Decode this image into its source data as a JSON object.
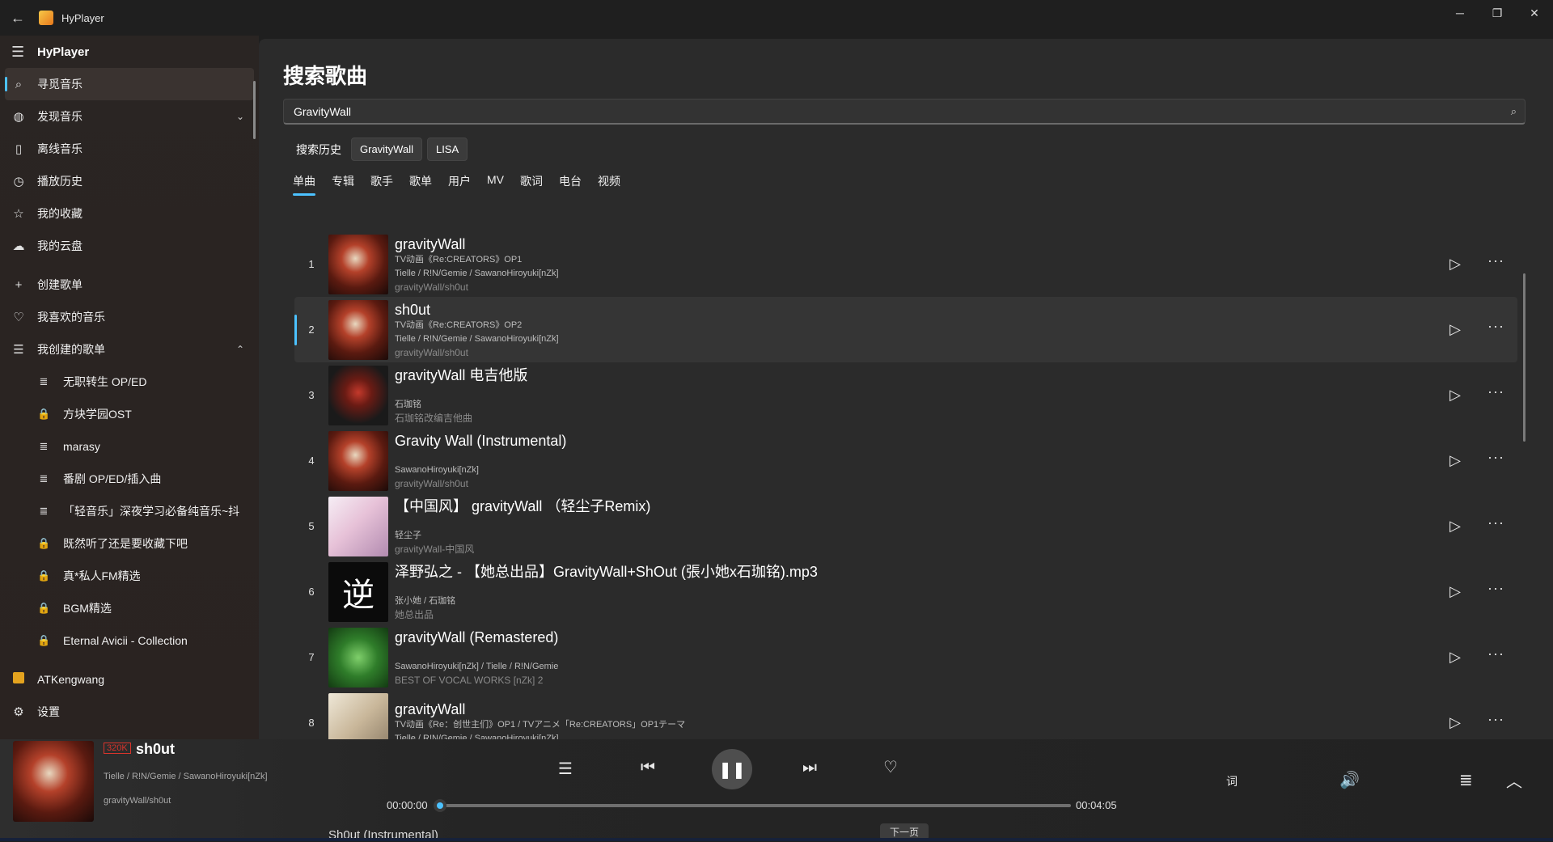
{
  "window": {
    "title": "HyPlayer",
    "controls": [
      "─",
      "❐",
      "✕"
    ]
  },
  "sidebar": {
    "header": "HyPlayer",
    "nav": [
      {
        "label": "寻觅音乐",
        "icon": "search-icon",
        "glyph": "⌕",
        "active": true
      },
      {
        "label": "发现音乐",
        "icon": "globe-icon",
        "glyph": "◍",
        "expandable": true
      },
      {
        "label": "离线音乐",
        "icon": "bookmark-icon",
        "glyph": "▯"
      },
      {
        "label": "播放历史",
        "icon": "clock-icon",
        "glyph": "◷"
      },
      {
        "label": "我的收藏",
        "icon": "star-icon",
        "glyph": "☆"
      },
      {
        "label": "我的云盘",
        "icon": "cloud-icon",
        "glyph": "☁"
      }
    ],
    "actions": [
      {
        "label": "创建歌单",
        "icon": "plus-icon",
        "glyph": "+"
      },
      {
        "label": "我喜欢的音乐",
        "icon": "heart-icon",
        "glyph": "♡"
      },
      {
        "label": "我创建的歌单",
        "icon": "list-icon",
        "glyph": "☰",
        "expanded": true
      }
    ],
    "playlists": [
      {
        "label": "无职转生 OP/ED",
        "icon": "playlist-icon",
        "glyph": "≣"
      },
      {
        "label": "方块学园OST",
        "icon": "lock-icon",
        "glyph": "🔒"
      },
      {
        "label": "marasy",
        "icon": "playlist-icon",
        "glyph": "≣"
      },
      {
        "label": "番剧 OP/ED/插入曲",
        "icon": "playlist-icon",
        "glyph": "≣"
      },
      {
        "label": "「轻音乐」深夜学习必备纯音乐~抖",
        "icon": "playlist-icon",
        "glyph": "≣"
      },
      {
        "label": "既然听了还是要收藏下吧",
        "icon": "lock-icon",
        "glyph": "🔒"
      },
      {
        "label": "真*私人FM精选",
        "icon": "lock-icon",
        "glyph": "🔒"
      },
      {
        "label": "BGM精选",
        "icon": "lock-icon",
        "glyph": "🔒"
      },
      {
        "label": "Eternal Avicii - Collection",
        "icon": "lock-icon",
        "glyph": "🔒"
      }
    ],
    "user": "ATKengwang",
    "settings": "设置"
  },
  "main": {
    "title": "搜索歌曲",
    "search": {
      "value": "GravityWall"
    },
    "history_label": "搜索历史",
    "history": [
      "GravityWall",
      "LISA"
    ],
    "tabs": [
      "单曲",
      "专辑",
      "歌手",
      "歌单",
      "用户",
      "MV",
      "歌词",
      "电台",
      "视频"
    ],
    "active_tab": "单曲",
    "songs": [
      {
        "num": "1",
        "title": "gravityWall",
        "line1": "TV动画《Re:CREATORS》OP1",
        "line2": "Tielle / R!N/Gemie / SawanoHiroyuki[nZk]",
        "album": "gravityWall/sh0ut",
        "cover": "cv-fire"
      },
      {
        "num": "2",
        "title": "sh0ut",
        "line1": "TV动画《Re:CREATORS》OP2",
        "line2": "Tielle / R!N/Gemie / SawanoHiroyuki[nZk]",
        "album": "gravityWall/sh0ut",
        "cover": "cv-fire",
        "highlight": true
      },
      {
        "num": "3",
        "title": "gravityWall 电吉他版",
        "line1": "",
        "line2": "石珈铭",
        "album": "石珈铭改编吉他曲",
        "cover": "cv-guitar"
      },
      {
        "num": "4",
        "title": "Gravity Wall (Instrumental)",
        "line1": "",
        "line2": "SawanoHiroyuki[nZk]",
        "album": "gravityWall/sh0ut",
        "cover": "cv-fire"
      },
      {
        "num": "5",
        "title": "【中国风】 gravityWall （轻尘子Remix)",
        "line1": "",
        "line2": "轻尘子",
        "album": "gravityWall-中国风",
        "cover": "cv-pink"
      },
      {
        "num": "6",
        "title": "泽野弘之 - 【她总出品】GravityWall+ShOut (張小她x石珈铭).mp3",
        "line1": "",
        "line2": "张小她 / 石珈铭",
        "album": "她总出品",
        "cover": "cv-black"
      },
      {
        "num": "7",
        "title": "gravityWall (Remastered)",
        "line1": "",
        "line2": "SawanoHiroyuki[nZk] / Tielle / R!N/Gemie",
        "album": "BEST OF VOCAL WORKS [nZk] 2",
        "cover": "cv-green"
      },
      {
        "num": "8",
        "title": "gravityWall",
        "line1": "TV动画《Re：创世主们》OP1 / TVアニメ「Re:CREATORS」OP1テーマ",
        "line2": "Tielle / R!N/Gemie / SawanoHiroyuki[nZk]",
        "album": "",
        "cover": "cv-light"
      }
    ],
    "next_page": "下一页",
    "peek_title": "Sh0ut (Instrumental)"
  },
  "player": {
    "quality": "320K",
    "title": "sh0ut",
    "artist": "Tielle / R!N/Gemie / SawanoHiroyuki[nZk]",
    "album": "gravityWall/sh0ut",
    "time_current": "00:00:00",
    "time_total": "00:04:05",
    "progress": 0.0,
    "lyric_btn": "词"
  }
}
